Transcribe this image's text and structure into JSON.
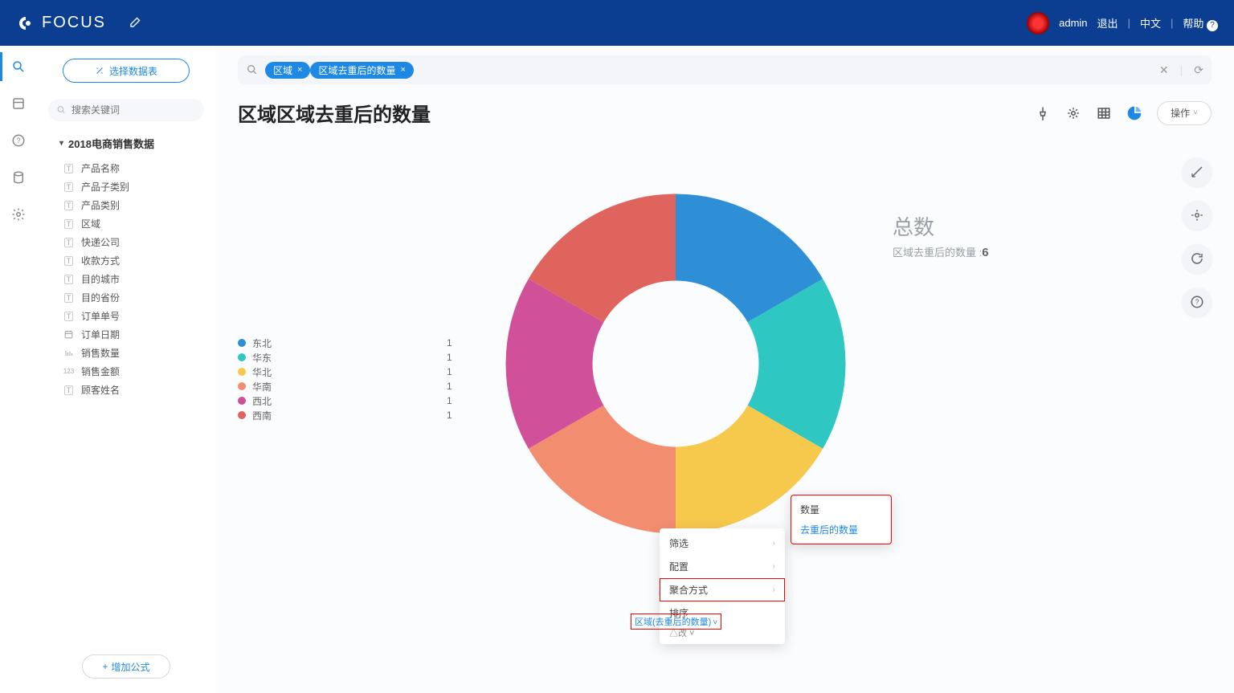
{
  "brand": "FOCUS",
  "header": {
    "user": "admin",
    "logout": "退出",
    "lang": "中文",
    "help": "帮助"
  },
  "sidebar": {
    "select_btn": "选择数据表",
    "search_placeholder": "搜索关键词",
    "dataset": "2018电商销售数据",
    "fields": [
      {
        "icon": "T",
        "label": "产品名称"
      },
      {
        "icon": "T",
        "label": "产品子类别"
      },
      {
        "icon": "T",
        "label": "产品类别"
      },
      {
        "icon": "T",
        "label": "区域"
      },
      {
        "icon": "T",
        "label": "快递公司"
      },
      {
        "icon": "T",
        "label": "收款方式"
      },
      {
        "icon": "T",
        "label": "目的城市"
      },
      {
        "icon": "T",
        "label": "目的省份"
      },
      {
        "icon": "T",
        "label": "订单单号"
      },
      {
        "icon": "cal",
        "label": "订单日期"
      },
      {
        "icon": "num",
        "label": "销售数量"
      },
      {
        "icon": "123",
        "label": "销售金额"
      },
      {
        "icon": "T",
        "label": "顾客姓名"
      }
    ],
    "add_formula": "增加公式"
  },
  "query": {
    "chips": [
      "区域",
      "区域去重后的数量"
    ]
  },
  "page_title": "区域区域去重后的数量",
  "op_btn": "操作",
  "totals": {
    "label": "总数",
    "metric": "区域去重后的数量 :",
    "value": "6"
  },
  "chart_data": {
    "type": "pie",
    "title": "区域区域去重后的数量",
    "categories": [
      "东北",
      "华东",
      "华北",
      "华南",
      "西北",
      "西南"
    ],
    "values": [
      1,
      1,
      1,
      1,
      1,
      1
    ],
    "colors": [
      "#2f8fd6",
      "#2ec7c2",
      "#f6c84c",
      "#f28e6f",
      "#d05099",
      "#e0645e"
    ],
    "legend_position": "left",
    "donut": true
  },
  "context_menu": {
    "items": [
      {
        "label": "筛选",
        "sub": true
      },
      {
        "label": "配置",
        "sub": true
      },
      {
        "label": "聚合方式",
        "sub": true,
        "hl": true
      },
      {
        "label": "排序"
      }
    ],
    "more": "△改 ˅",
    "field_tag": "区域(去重后的数量)"
  },
  "sub_menu": {
    "items": [
      {
        "label": "数量"
      },
      {
        "label": "去重后的数量",
        "link": true
      }
    ]
  }
}
